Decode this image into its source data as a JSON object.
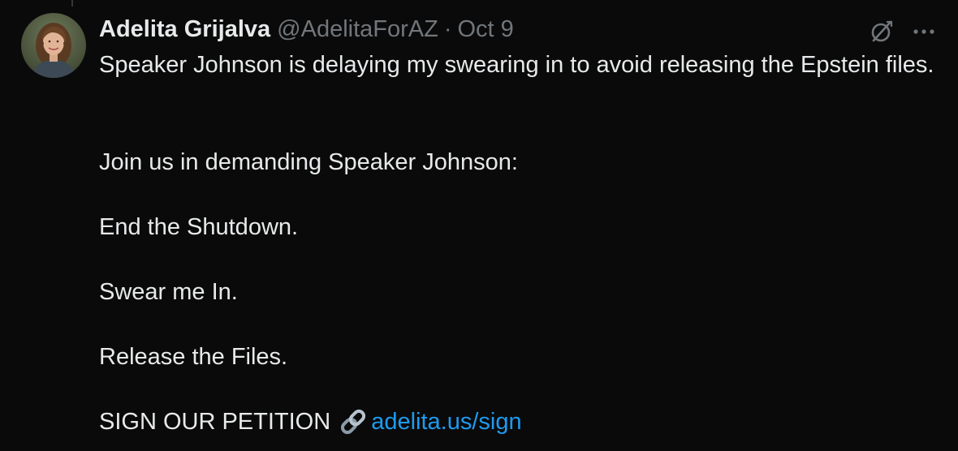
{
  "tweet": {
    "author": {
      "display_name": "Adelita Grijalva",
      "handle": "@AdelitaForAZ",
      "separator": "·",
      "date": "Oct 9"
    },
    "icons": {
      "grok": "grok-icon",
      "more": "more-options-icon",
      "link_emoji": "link-emoji-icon"
    },
    "colors": {
      "background": "#0a0a0a",
      "text": "#e7e9ea",
      "muted": "#71767b",
      "link": "#1d9bf0"
    },
    "text": {
      "p1": "Speaker Johnson is delaying my swearing in to avoid releasing the Epstein files.",
      "p2": "Join us in demanding Speaker Johnson:",
      "p3": "End the Shutdown.",
      "p4": "Swear me In.",
      "p5": "Release the Files.",
      "p6_prefix": "SIGN OUR PETITION",
      "link_text": "adelita.us/sign"
    }
  }
}
